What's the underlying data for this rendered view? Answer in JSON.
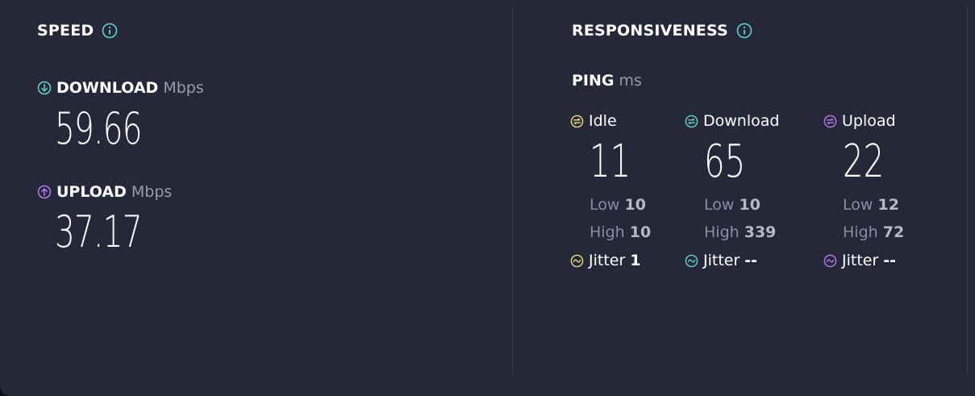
{
  "speed": {
    "title": "SPEED",
    "download": {
      "label": "DOWNLOAD",
      "unit": "Mbps",
      "value": "59.66"
    },
    "upload": {
      "label": "UPLOAD",
      "unit": "Mbps",
      "value": "37.17"
    }
  },
  "responsiveness": {
    "title": "RESPONSIVENESS",
    "ping": {
      "label": "PING",
      "unit": "ms",
      "columns": [
        {
          "label": "Idle",
          "value": "11",
          "low_label": "Low",
          "low": "10",
          "high_label": "High",
          "high": "10",
          "jitter_label": "Jitter",
          "jitter": "1"
        },
        {
          "label": "Download",
          "value": "65",
          "low_label": "Low",
          "low": "10",
          "high_label": "High",
          "high": "339",
          "jitter_label": "Jitter",
          "jitter": "--"
        },
        {
          "label": "Upload",
          "value": "22",
          "low_label": "Low",
          "low": "12",
          "high_label": "High",
          "high": "72",
          "jitter_label": "Jitter",
          "jitter": "--"
        }
      ]
    }
  },
  "colors": {
    "background": "#262738",
    "download_accent": "#5fd7c9",
    "upload_accent": "#b57bee",
    "idle_accent": "#e8e27a",
    "muted_text": "#9a9bad"
  },
  "icons": {
    "info": "info-icon",
    "download": "arrow-down-circle-icon",
    "upload": "arrow-up-circle-icon",
    "ping": "ping-circle-icon",
    "jitter": "wave-circle-icon"
  }
}
